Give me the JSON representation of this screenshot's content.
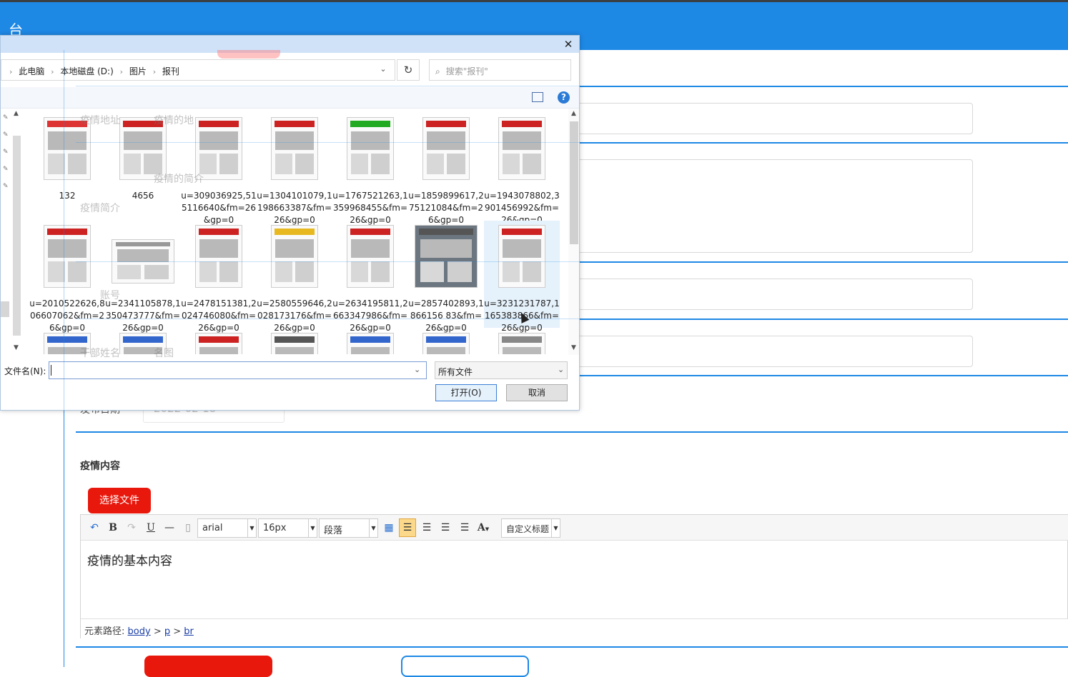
{
  "header": {
    "title": "管理后台",
    "visible_fragment": "台"
  },
  "form": {
    "date_label": "发布日期",
    "date_value": "2022-02-18",
    "content_label": "疫情内容",
    "choose_file_label": "选择文件",
    "ghost_labels": [
      "疫情地址",
      "疫情的地",
      "疫情的简介",
      "疫情简介",
      "账号",
      "干部姓名",
      "名图"
    ]
  },
  "editor": {
    "font_family": "arial",
    "font_size": "16px",
    "paragraph": "段落",
    "custom_title": "自定义标题",
    "content": "疫情的基本内容",
    "path_label": "元素路径:",
    "path": [
      "body",
      "p",
      "br"
    ]
  },
  "dialog": {
    "breadcrumb": [
      "此电脑",
      "本地磁盘 (D:)",
      "图片",
      "报刊"
    ],
    "search_placeholder": "搜索\"报刊\"",
    "filename_label": "文件名(N):",
    "filename_value": "",
    "filter_value": "所有文件",
    "open_label": "打开(O)",
    "cancel_label": "取消",
    "files": [
      {
        "name": "132",
        "accent": "#d33"
      },
      {
        "name": "4656",
        "accent": "#c22"
      },
      {
        "name": "u=309036925,515116640&fm=26&gp=0",
        "accent": "#c22"
      },
      {
        "name": "u=1304101079,1198663387&fm=26&gp=0",
        "accent": "#c22"
      },
      {
        "name": "u=1767521263,1359968455&fm=26&gp=0",
        "accent": "#2a2"
      },
      {
        "name": "u=1859899617,275121084&fm=26&gp=0",
        "accent": "#c22"
      },
      {
        "name": "u=1943078802,3901456992&fm=26&gp=0",
        "accent": "#c22"
      },
      {
        "name": "u=2010522626,806607062&fm=26&gp=0",
        "accent": "#c22"
      },
      {
        "name": "u=2341105878,1350473777&fm=26&gp=0",
        "accent": "#999"
      },
      {
        "name": "u=2478151381,2024746080&fm=26&gp=0",
        "accent": "#c22"
      },
      {
        "name": "u=2580559646,2028173176&fm=26&gp=0",
        "accent": "#e8b820"
      },
      {
        "name": "u=2634195811,2663347986&fm=26&gp=0",
        "accent": "#c22"
      },
      {
        "name": "u=2857402893,1866156 83&fm=26&gp=0",
        "accent": "#555"
      },
      {
        "name": "u=3231231787,1165383866&fm=26&gp=0",
        "accent": "#c22"
      }
    ],
    "partial_row_accents": [
      "#36c",
      "#36c",
      "#c22",
      "#555",
      "#36c",
      "#36c",
      "#888"
    ]
  },
  "colors": {
    "primary": "#1e88e5",
    "danger": "#e8180c"
  }
}
